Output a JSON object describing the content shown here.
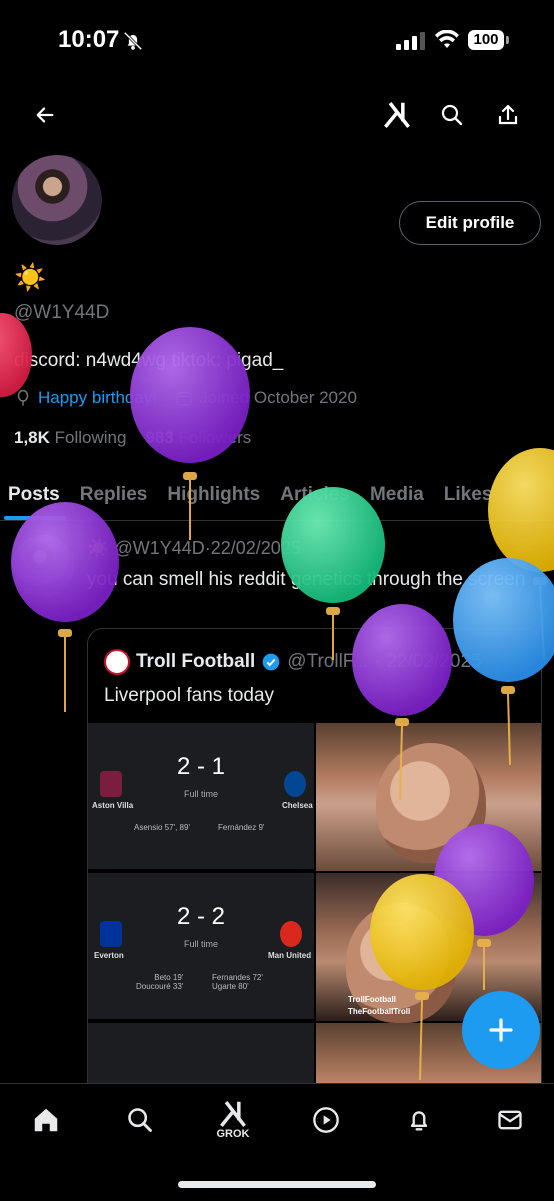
{
  "status_bar": {
    "time": "10:07",
    "battery": "100"
  },
  "header": {
    "icons": [
      "back-arrow-icon",
      "grok-icon",
      "search-icon",
      "share-icon"
    ]
  },
  "profile": {
    "emoji": "☀️",
    "handle": "@W1Y44D",
    "bio": "discord: n4wd4wg tiktok: pigad_",
    "birthday": "Happy birthday!",
    "joined": "Joined October 2020",
    "following_count": "1,8K",
    "following_label": "Following",
    "followers_count": "983",
    "followers_label": "Followers",
    "edit_button": "Edit profile"
  },
  "tabs": [
    "Posts",
    "Replies",
    "Highlights",
    "Articles",
    "Media",
    "Likes"
  ],
  "active_tab": "Posts",
  "post": {
    "emoji": "☀️",
    "author_handle": "@W1Y44D",
    "separator": "·",
    "date": "22/02/2025",
    "text": "you can smell his reddit genetics through the screen",
    "quote": {
      "name": "Troll Football",
      "handle": "@TrollF...",
      "date": "22/02/2025",
      "text": "Liverpool fans today",
      "matches": [
        {
          "home": "Aston Villa",
          "away": "Chelsea",
          "score": "2 - 1",
          "status": "Full time",
          "home_scorers": "Asensio 57', 89'",
          "away_scorers": "Fernández 9'"
        },
        {
          "home": "Everton",
          "away": "Man United",
          "score": "2 - 2",
          "status": "Full time",
          "home_scorers": "Beto 19'\nDoucouré 33'",
          "away_scorers": "Fernandes 72'\nUgarte 80'"
        }
      ],
      "watermark_1": "TrollFootball",
      "watermark_2": "TheFootballTroll"
    }
  },
  "fab": {
    "label": "+"
  },
  "bottom_nav": {
    "grok_label": "GROK"
  },
  "colors": {
    "accent": "#1d9bf0",
    "background": "#000000",
    "muted": "#71767b"
  }
}
